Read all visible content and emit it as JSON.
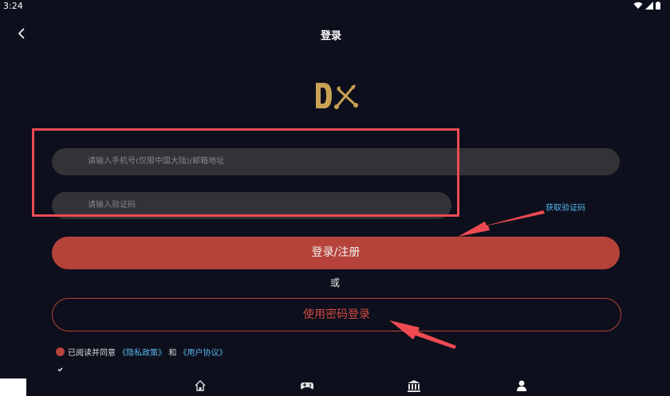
{
  "status": {
    "time": "3:24"
  },
  "header": {
    "title": "登录"
  },
  "form": {
    "phone_placeholder": "请输入手机号(仅限中国大陆)/邮箱地址",
    "code_placeholder": "请输入验证码",
    "get_code_label": "获取验证码",
    "login_button": "登录/注册",
    "or_label": "或",
    "password_login_button": "使用密码登录"
  },
  "agreement": {
    "prefix": "已阅读并同意 ",
    "privacy_link": "《隐私政策》",
    "and": " 和 ",
    "user_link": "《用户协议》"
  },
  "bottom_nav": {
    "items": [
      "home-icon",
      "gamepad-icon",
      "bank-icon",
      "user-icon"
    ],
    "active": 3
  },
  "colors": {
    "background": "#0d0f1c",
    "accent": "#b5433a",
    "link": "#56b7f0",
    "annotation": "#ef4a52",
    "logo": "#c9a255"
  }
}
